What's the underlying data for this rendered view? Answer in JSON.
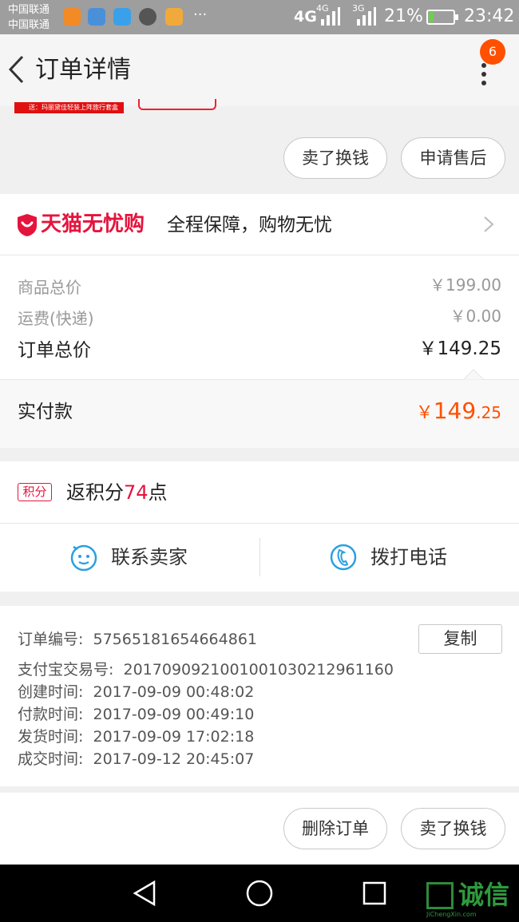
{
  "status_bar": {
    "carrier_1": "中国联通",
    "carrier_2": "中国联通",
    "net_1": "4G",
    "net_2": "4G",
    "net_3": "3G",
    "battery": "21%",
    "battery_level": 0.21,
    "time": "23:42",
    "more": "···",
    "app_icon_colors": [
      "#f28a25",
      "#4a90d9",
      "#3aa0ea",
      "#555555",
      "#f2a93b"
    ]
  },
  "header": {
    "title": "订单详情",
    "badge": "6"
  },
  "product": {
    "strip_text": "送：玛丽黛佳轻装上阵旅行套盒"
  },
  "top_actions": {
    "sell_label": "卖了换钱",
    "after_sale_label": "申请售后"
  },
  "tmall": {
    "brand": "天猫无忧购",
    "tagline": "全程保障，购物无忧",
    "brand_color": "#e5143d"
  },
  "prices": {
    "goods_total_label": "商品总价",
    "goods_total_value": "￥199.00",
    "shipping_label": "运费(快递)",
    "shipping_value": "￥0.00",
    "order_total_label": "订单总价",
    "order_total_value": "￥149.25",
    "paid_label": "实付款",
    "paid_symbol": "￥",
    "paid_int": "149",
    "paid_dec": ".25",
    "accent_color": "#ff5000"
  },
  "points": {
    "tag": "积分",
    "prefix": "返积分",
    "value": "74",
    "suffix": "点"
  },
  "contact": {
    "seller_label": "联系卖家",
    "phone_label": "拨打电话",
    "icon_color": "#2b9fe0"
  },
  "order_info": {
    "order_no_label": "订单编号:",
    "order_no": "57565181654664861",
    "copy_label": "复制",
    "alipay_label": "支付宝交易号:",
    "alipay_no": "2017090921001001030212961160",
    "created_label": "创建时间:",
    "created": "2017-09-09 00:48:02",
    "paid_label": "付款时间:",
    "paid": "2017-09-09 00:49:10",
    "shipped_label": "发货时间:",
    "shipped": "2017-09-09 17:02:18",
    "closed_label": "成交时间:",
    "closed": "2017-09-12 20:45:07"
  },
  "bottom_actions": {
    "delete_label": "删除订单",
    "sell_label": "卖了换钱"
  },
  "watermark": {
    "text": "诚信",
    "sub": "JiChengXin.com"
  }
}
